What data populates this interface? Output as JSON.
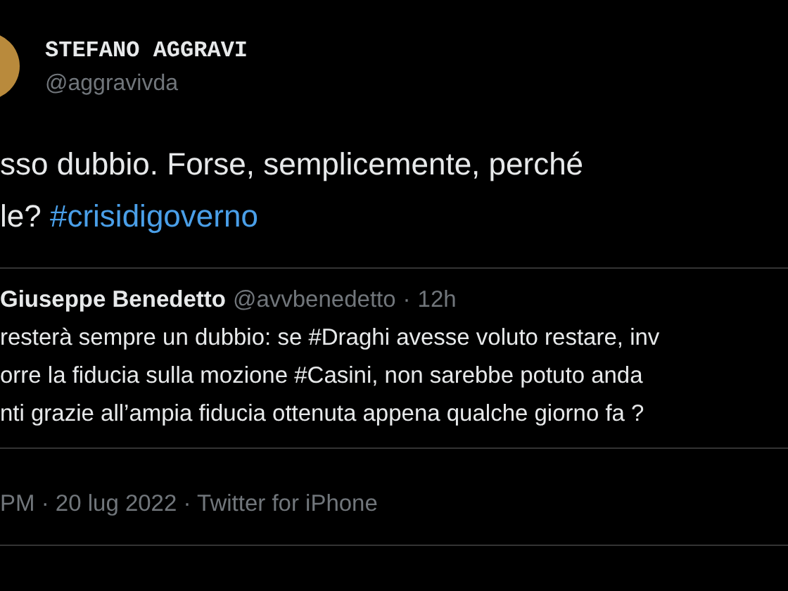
{
  "author": {
    "name": "STEFANO AGGRAVI",
    "handle": "@aggravivda"
  },
  "tweet_lines": [
    [
      {
        "kind": "text",
        "text": "sso dubbio. Forse, semplicemente, perché"
      }
    ],
    [
      {
        "kind": "text",
        "text": "le? "
      },
      {
        "kind": "hashtag",
        "text": "#crisidigoverno"
      }
    ]
  ],
  "quoted": {
    "name": "Giuseppe Benedetto",
    "handle": "@avvbenedetto",
    "separator": "·",
    "time": "12h",
    "lines": [
      "resterà sempre un dubbio: se #Draghi avesse voluto restare, inv",
      "orre la fiducia sulla mozione #Casini, non sarebbe potuto anda",
      "nti grazie  all’ampia fiducia ottenuta appena qualche giorno fa ?"
    ]
  },
  "timestamp": "PM · 20 lug 2022 · Twitter for iPhone"
}
